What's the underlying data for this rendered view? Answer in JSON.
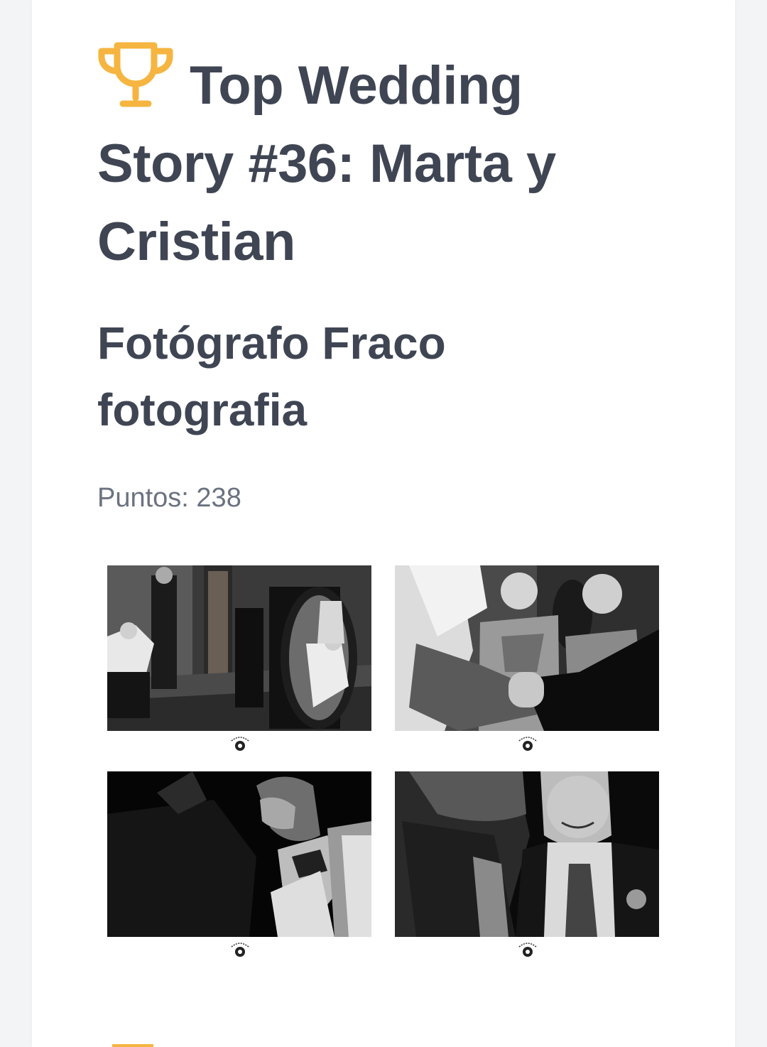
{
  "post": {
    "title": "Top Wedding Story #36: Marta y Cristian",
    "photographer": "Fotógrafo Fraco fotografia",
    "points_label": "Puntos: 238"
  },
  "icons": {
    "title_icon": "trophy-icon",
    "watermark": "wedding-story-logo-icon"
  },
  "colors": {
    "accent": "#f5b540",
    "heading": "#3f4553",
    "muted": "#6b7280",
    "background": "#f3f4f6",
    "card": "#ffffff"
  },
  "gallery": {
    "photos": [
      {
        "name": "groom-preparation-room"
      },
      {
        "name": "bridesmaids-watching"
      },
      {
        "name": "adjusting-bow-tie"
      },
      {
        "name": "groom-smiling"
      }
    ]
  }
}
